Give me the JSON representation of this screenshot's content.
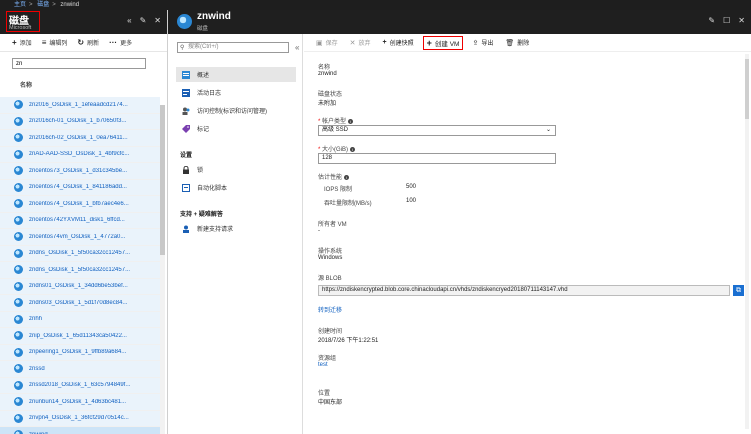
{
  "breadcrumb": [
    "主页",
    "磁盘",
    "znwind"
  ],
  "left_blade": {
    "title": "磁盘",
    "subtitle": "Microsoft",
    "toolbar": {
      "add": "添加",
      "edit_columns": "编辑列",
      "refresh": "刷新",
      "more": "更多"
    },
    "filter_value": "zn",
    "column_header": "名称",
    "items": [
      "zn2016_OsDisk_1_1efeaadcd2174...",
      "zn2016ch-01_OsDisk_1_b70650f3...",
      "zn2016ch-02_OsDisk_1_0ea76411...",
      "znAD-AAD-SSD_OsDisk_1_4bf9cfc...",
      "zncentos73_OsDisk_1_d31c345be...",
      "zncentos74_OsDisk_1_841186add...",
      "zncentos74_OsDisk_1_bfb7aec4e6...",
      "zncentos742YXVM11_disk1_6ffcd...",
      "zncentos74vm_OsDisk_1_4772a0...",
      "zndns_OsDisk_1_5f50ca32cc12457...",
      "zndns_OsDisk_1_5f50ca32cc12457...",
      "zndns01_OsDisk_1_34dd6be53bef...",
      "zndns03_OsDisk_1_5d1f70d8ec84...",
      "znhh",
      "znip_OsDisk_1_65d11343ca50422...",
      "znpeering1_OsDisk_1_9ffb89a684...",
      "znssd",
      "znssd2018_OsDisk_1_63c5794849f...",
      "znunbun14_OsDisk_1_4d63bc481...",
      "znvpn4_OsDisk_1_36fcf29d70514c...",
      "znwind"
    ],
    "selected_index": 20
  },
  "right_blade": {
    "title": "znwind",
    "subtitle": "磁盘",
    "menu": {
      "search_placeholder": "搜索(Ctrl+/)",
      "items": [
        "概述",
        "活动日志",
        "访问控制(标识和访问管理)",
        "标记"
      ],
      "settings_section": "设置",
      "settings_items": [
        "锁",
        "自动化脚本"
      ],
      "support_section": "支持 + 疑难解答",
      "support_items": [
        "新建支持请求"
      ]
    },
    "commands": {
      "save": "保存",
      "discard": "放弃",
      "create_snapshot": "创建快照",
      "create_vm": "创建 VM",
      "export": "导出",
      "delete": "删除"
    },
    "props": {
      "name_label": "名称",
      "name_value": "znwind",
      "state_label": "磁盘状态",
      "state_value": "未附加",
      "account_type_label": "帐户类型",
      "account_type_value": "高级 SSD",
      "size_label": "大小(GiB)",
      "size_value": "128",
      "perf_label": "估计性能",
      "iops_label": "IOPS 限制",
      "iops_value": "500",
      "throughput_label": "吞吐量限制(MB/s)",
      "throughput_value": "100",
      "owner_label": "所有者 VM",
      "owner_value": "-",
      "os_label": "操作系统",
      "os_value": "Windows",
      "blob_label": "源 BLOB",
      "blob_value": "https://zndiskencrypted.blob.core.chinacloudapi.cn/vhds/zndiskencryed20180711143147.vhd",
      "migrate_link": "转到迁移",
      "created_label": "创建时间",
      "created_value": "2018/7/26 下午1:22:51",
      "rg_label": "资源组",
      "rg_value": "test",
      "location_label": "位置",
      "location_value": "中国东部"
    }
  }
}
